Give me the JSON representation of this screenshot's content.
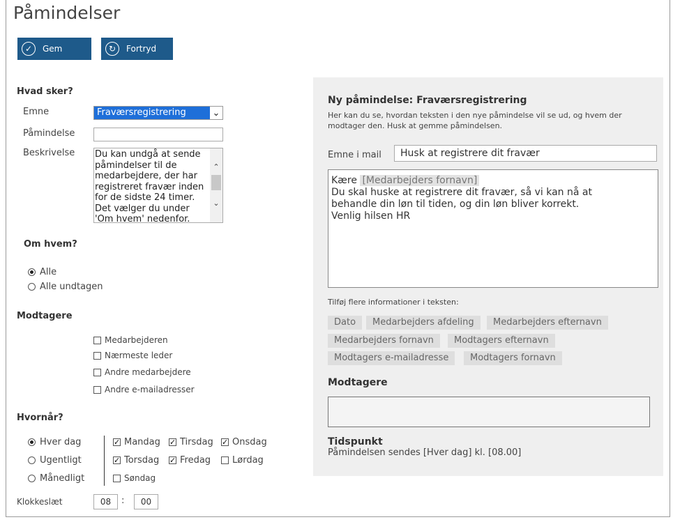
{
  "title": "Påmindelser",
  "toolbar": {
    "save_label": "Gem",
    "undo_label": "Fortryd"
  },
  "form": {
    "section_what": "Hvad sker?",
    "subject_label": "Emne",
    "subject_value": "Fraværsregistrering",
    "reminder_label": "Påmindelse",
    "reminder_value": "",
    "description_label": "Beskrivelse",
    "description_value": "Du kan undgå at sende påmindelser til de medarbejdere, der har registreret fravær inden for de sidste 24 timer. Det vælger du under 'Om hvem' nedenfor.",
    "section_who": "Om hvem?",
    "who_options": [
      {
        "label": "Alle",
        "selected": true
      },
      {
        "label": "Alle undtagen",
        "selected": false
      }
    ],
    "section_recipients": "Modtagere",
    "recipients": [
      {
        "label": "Medarbejderen",
        "checked": false
      },
      {
        "label": "Nærmeste leder",
        "checked": false
      },
      {
        "label": "Andre medarbejdere",
        "checked": false
      },
      {
        "label": "Andre e-mailadresser",
        "checked": false
      }
    ],
    "section_when": "Hvornår?",
    "frequency_options": [
      {
        "label": "Hver dag",
        "selected": true
      },
      {
        "label": "Ugentligt",
        "selected": false
      },
      {
        "label": "Månedligt",
        "selected": false
      }
    ],
    "days": [
      {
        "label": "Mandag",
        "checked": true
      },
      {
        "label": "Tirsdag",
        "checked": true
      },
      {
        "label": "Onsdag",
        "checked": true
      },
      {
        "label": "Torsdag",
        "checked": true
      },
      {
        "label": "Fredag",
        "checked": true
      },
      {
        "label": "Lørdag",
        "checked": false
      },
      {
        "label": "Søndag",
        "checked": false
      }
    ],
    "time_label": "Klokkeslæt",
    "time_hour": "08",
    "time_separator": ":",
    "time_minute": "00"
  },
  "preview": {
    "title": "Ny påmindelse: Fraværsregistrering",
    "description": "Her kan du se, hvordan teksten i den nye påmindelse vil se ud, og hvem der modtager den. Husk at gemme påmindelsen.",
    "mail_subject_label": "Emne i mail",
    "mail_subject_value": "Husk at registrere dit fravær",
    "body_greeting": "Kære",
    "body_tag": "[Medarbejders fornavn]",
    "body_line1": "Du skal huske at registrere dit fravær, så vi kan nå at",
    "body_line2": "behandle din løn til tiden, og din løn bliver korrekt.",
    "body_line3": "Venlig hilsen HR",
    "add_info_label": "Tilføj flere informationer i teksten:",
    "tags": [
      "Dato",
      "Medarbejders afdeling",
      "Medarbejders efternavn",
      "Medarbejders fornavn",
      "Modtagers efternavn",
      "Modtagers e-mailadresse",
      "Modtagers fornavn"
    ],
    "recipients_title": "Modtagere",
    "timing_title": "Tidspunkt",
    "timing_text": "Påmindelsen sendes [Hver dag] kl. [08.00]"
  },
  "colors": {
    "button_bg": "#1e5a8a",
    "select_highlight": "#1e6fd9",
    "panel_bg": "#efefef"
  },
  "icons": {
    "save": "check-circle-icon",
    "undo": "undo-circle-icon"
  }
}
